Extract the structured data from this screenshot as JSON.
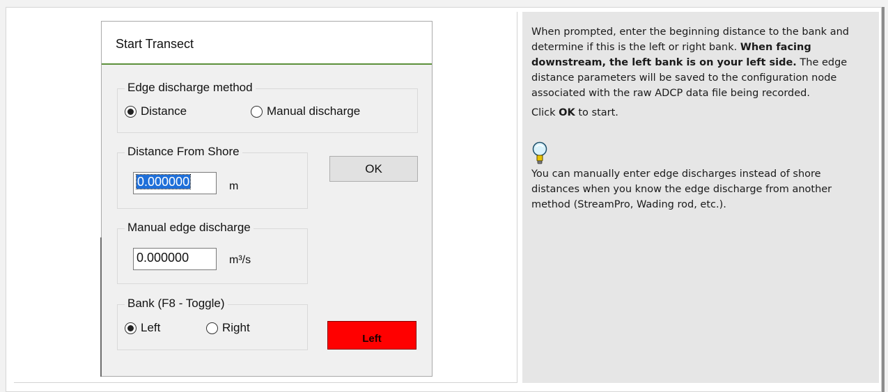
{
  "dialog": {
    "title": "Start Transect",
    "edge_method": {
      "label": "Edge discharge method",
      "options": [
        "Distance",
        "Manual discharge"
      ],
      "selected": "Distance"
    },
    "distance": {
      "label": "Distance From Shore",
      "value": "0.000000",
      "unit": "m"
    },
    "ok_label": "OK",
    "manual_edge": {
      "label": "Manual edge discharge",
      "value": "0.000000",
      "unit": "m³/s"
    },
    "bank": {
      "label": "Bank (F8 - Toggle)",
      "options": [
        "Left",
        "Right"
      ],
      "selected": "Left",
      "indicator": "Left",
      "indicator_color": "#ff0000"
    }
  },
  "help": {
    "p1_a": "When prompted, enter the beginning distance to the bank and determine if this is the left or right bank. ",
    "p1_bold": "When facing downstream, the left bank is on your left side.",
    "p1_b": " The edge distance parameters will be saved to the configuration node associated with the raw ADCP data file being recorded.",
    "p2_a": "Click ",
    "p2_bold": "OK",
    "p2_b": " to start.",
    "tip_icon": "lightbulb-icon",
    "tip": " You can manually enter edge discharges instead of shore distances when you know the edge discharge from another method (StreamPro, Wading rod, etc.)."
  }
}
